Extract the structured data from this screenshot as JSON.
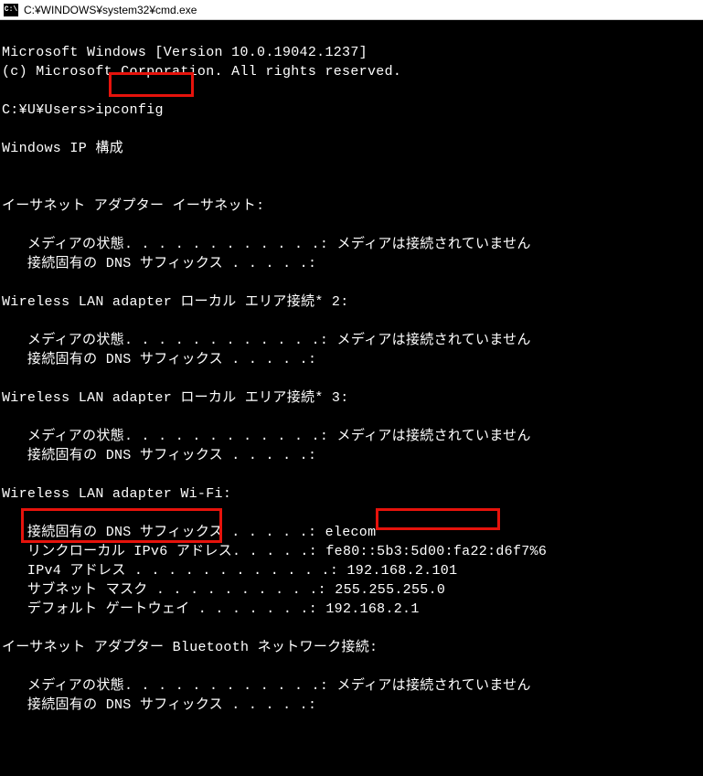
{
  "titlebar": {
    "icon_label": "C:\\",
    "path": "C:¥WINDOWS¥system32¥cmd.exe"
  },
  "header": {
    "line1": "Microsoft Windows [Version 10.0.19042.1237]",
    "line2": "(c) Microsoft Corporation. All rights reserved."
  },
  "prompt": {
    "path": "C:¥U¥Users>",
    "command": "ipconfig"
  },
  "ip_header": "Windows IP 構成",
  "adapters": [
    {
      "title": "イーサネット アダプター イーサネット:",
      "rows": [
        {
          "label": "メディアの状態. . . . . . . . . . . .:",
          "value": "メディアは接続されていません"
        },
        {
          "label": "接続固有の DNS サフィックス . . . . .:",
          "value": ""
        }
      ]
    },
    {
      "title": "Wireless LAN adapter ローカル エリア接続* 2:",
      "rows": [
        {
          "label": "メディアの状態. . . . . . . . . . . .:",
          "value": "メディアは接続されていません"
        },
        {
          "label": "接続固有の DNS サフィックス . . . . .:",
          "value": ""
        }
      ]
    },
    {
      "title": "Wireless LAN adapter ローカル エリア接続* 3:",
      "rows": [
        {
          "label": "メディアの状態. . . . . . . . . . . .:",
          "value": "メディアは接続されていません"
        },
        {
          "label": "接続固有の DNS サフィックス . . . . .:",
          "value": ""
        }
      ]
    },
    {
      "title": "Wireless LAN adapter Wi-Fi:",
      "rows": [
        {
          "label": "接続固有の DNS サフィックス . . . . .:",
          "value": "elecom"
        },
        {
          "label": "リンクローカル IPv6 アドレス. . . . .:",
          "value": "fe80::5b3:5d00:fa22:d6f7%6"
        },
        {
          "label": "IPv4 アドレス . . . . . . . . . . . .:",
          "value": "192.168.2.101"
        },
        {
          "label": "サブネット マスク . . . . . . . . . .:",
          "value": "255.255.255.0"
        },
        {
          "label": "デフォルト ゲートウェイ . . . . . . .:",
          "value": "192.168.2.1"
        }
      ]
    },
    {
      "title": "イーサネット アダプター Bluetooth ネットワーク接続:",
      "rows": [
        {
          "label": "メディアの状態. . . . . . . . . . . .:",
          "value": "メディアは接続されていません"
        },
        {
          "label": "接続固有の DNS サフィックス . . . . .:",
          "value": ""
        }
      ]
    }
  ]
}
